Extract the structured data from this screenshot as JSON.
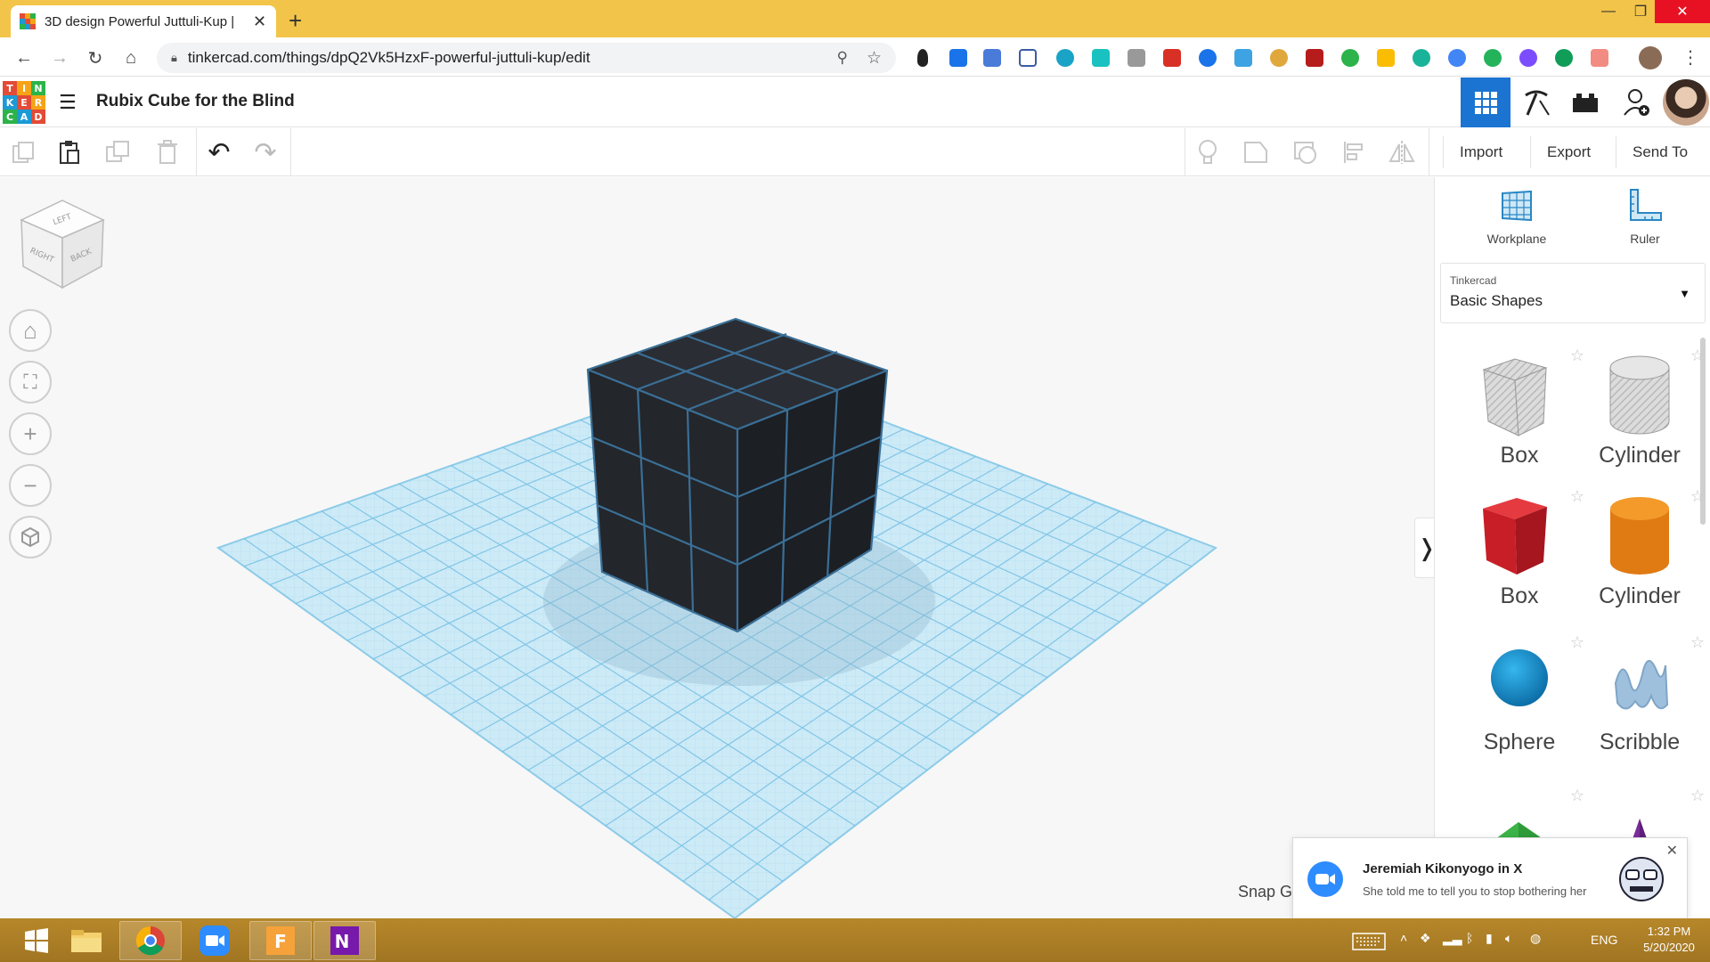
{
  "browser": {
    "tab_title": "3D design Powerful Juttuli-Kup |",
    "url": "tinkercad.com/things/dpQ2Vk5HzxF-powerful-juttuli-kup/edit"
  },
  "app": {
    "logo_letters": [
      "T",
      "I",
      "N",
      "K",
      "E",
      "R",
      "C",
      "A",
      "D"
    ],
    "logo_colors": [
      "#e34b36",
      "#f6a317",
      "#2cb34a",
      "#1c9ad6",
      "#e34b36",
      "#f6a317",
      "#2cb34a",
      "#1c9ad6",
      "#e34b36"
    ],
    "design_title": "Rubix Cube for the Blind",
    "accent_color": "#1b74d1"
  },
  "toolbar": {
    "import_label": "Import",
    "export_label": "Export",
    "send_to_label": "Send To"
  },
  "panel": {
    "workplane_label": "Workplane",
    "ruler_label": "Ruler",
    "library_category": "Tinkercad",
    "library_value": "Basic Shapes",
    "shapes": [
      {
        "label": "Box",
        "icon": "box-hole-icon"
      },
      {
        "label": "Cylinder",
        "icon": "cylinder-hole-icon"
      },
      {
        "label": "Box",
        "icon": "box-red-icon"
      },
      {
        "label": "Cylinder",
        "icon": "cylinder-orange-icon"
      },
      {
        "label": "Sphere",
        "icon": "sphere-blue-icon"
      },
      {
        "label": "Scribble",
        "icon": "scribble-icon"
      },
      {
        "label": "",
        "icon": "roof-green-icon"
      },
      {
        "label": "",
        "icon": "cone-purple-icon"
      }
    ]
  },
  "viewport": {
    "viewcube_faces": [
      "LEFT",
      "RIGHT",
      "BACK"
    ],
    "snap_grid_label": "Snap G"
  },
  "notification": {
    "sender": "Jeremiah Kikonyogo in X",
    "message": "She told me to tell you to stop bothering her"
  },
  "taskbar": {
    "language": "ENG",
    "time": "1:32 PM",
    "date": "5/20/2020"
  }
}
